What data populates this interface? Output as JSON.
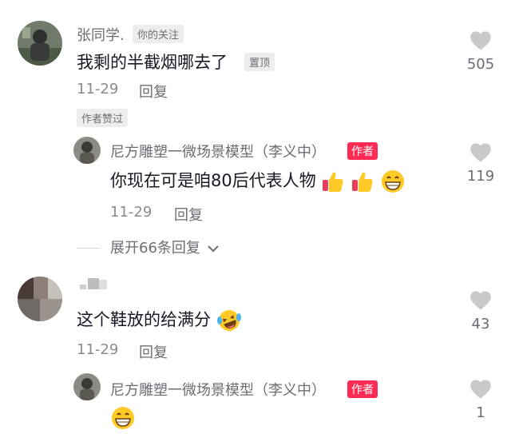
{
  "comments": [
    {
      "username": "张同学.",
      "follow_tag": "你的关注",
      "text": "我剩的半截烟哪去了",
      "pin_tag": "置顶",
      "date": "11-29",
      "reply_label": "回复",
      "author_liked_tag": "作者赞过",
      "likes": "505"
    },
    {
      "username": "",
      "text": "这个鞋放的给满分",
      "date": "11-29",
      "reply_label": "回复",
      "likes": "43"
    }
  ],
  "replies": [
    {
      "username": "尼方雕塑一微场景模型（李义中）",
      "author_tag": "作者",
      "text": "你现在可是咱80后代表人物",
      "date": "11-29",
      "reply_label": "回复",
      "likes": "119"
    },
    {
      "username": "尼方雕塑一微场景模型（李义中）",
      "author_tag": "作者",
      "likes": "1"
    }
  ],
  "expand_replies": "展开66条回复",
  "icons": {
    "like": "heart-icon",
    "expand": "chevron-down-icon",
    "emoji_thumb": "thumbs-up-emoji",
    "emoji_grin": "grinning-emoji",
    "emoji_laugh": "laughing-tears-emoji"
  },
  "colors": {
    "author_tag": "#fe2c55",
    "heart": "#c9c9cb",
    "secondary_text": "#6b6d75"
  }
}
